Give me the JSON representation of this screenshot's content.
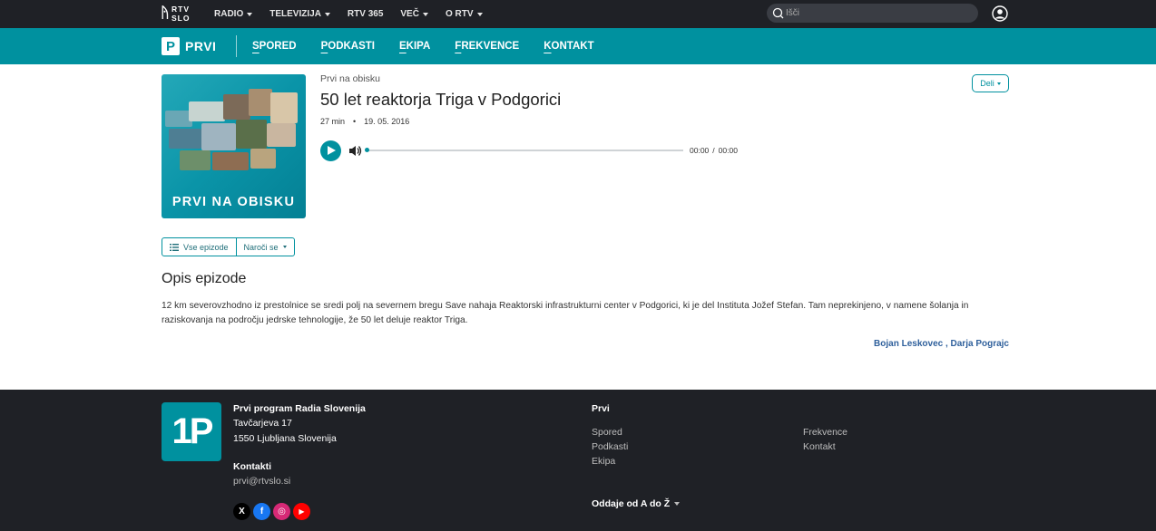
{
  "topbar": {
    "logo_line1": "RTV",
    "logo_line2": "SLO",
    "nav": [
      {
        "label": "RADIO",
        "dropdown": true
      },
      {
        "label": "TELEVIZIJA",
        "dropdown": true
      },
      {
        "label": "RTV 365",
        "dropdown": false
      },
      {
        "label": "VEČ",
        "dropdown": true
      },
      {
        "label": "O RTV",
        "dropdown": true
      }
    ],
    "search_placeholder": "Išči"
  },
  "section_bar": {
    "logo_mark": "P",
    "logo_text": "PRVI",
    "nav": [
      "SPORED",
      "PODKASTI",
      "EKIPA",
      "FREKVENCE",
      "KONTAKT"
    ]
  },
  "episode": {
    "cover_title": "PRVI NA OBISKU",
    "show_name": "Prvi na obisku",
    "title": "50 let reaktorja Triga v Podgorici",
    "duration": "27 min",
    "separator": "•",
    "date": "19. 05. 2016",
    "time_current": "00:00",
    "time_sep": "/",
    "time_total": "00:00",
    "progress": 0
  },
  "share_label": "Deli",
  "buttons": {
    "all_episodes": "Vse epizode",
    "subscribe": "Naroči se"
  },
  "description": {
    "heading": "Opis epizode",
    "text": "12 km severovzhodno iz prestolnice se sredi polj na severnem bregu Save nahaja Reaktorski infrastrukturni center v Podgorici, ki je del Instituta Jožef Stefan. Tam neprekinjeno, v namene šolanja in raziskovanja na področju jedrske tehnologije, že 50 let deluje reaktor Triga.",
    "authors": "Bojan Leskovec , Darja Pograjc"
  },
  "footer": {
    "logo_mark": "1P",
    "org": "Prvi program Radia Slovenija",
    "street": "Tavčarjeva 17",
    "city": "1550 Ljubljana Slovenija",
    "contacts_heading": "Kontakti",
    "email": "prvi@rtvslo.si",
    "links_heading": "Prvi",
    "links_col1": [
      "Spored",
      "Podkasti",
      "Ekipa"
    ],
    "links_col2": [
      "Frekvence",
      "Kontakt"
    ],
    "atoz": "Oddaje od A do Ž",
    "social": [
      {
        "name": "x-icon",
        "glyph": "X",
        "color": "#000000"
      },
      {
        "name": "facebook-icon",
        "glyph": "f",
        "color": "#1877f2"
      },
      {
        "name": "instagram-icon",
        "glyph": "◎",
        "color": "#d62976"
      },
      {
        "name": "youtube-icon",
        "glyph": "▶",
        "color": "#ff0000"
      }
    ]
  },
  "colors": {
    "accent": "#00919f",
    "dark": "#1f2126",
    "author_link": "#2e5f9b"
  }
}
